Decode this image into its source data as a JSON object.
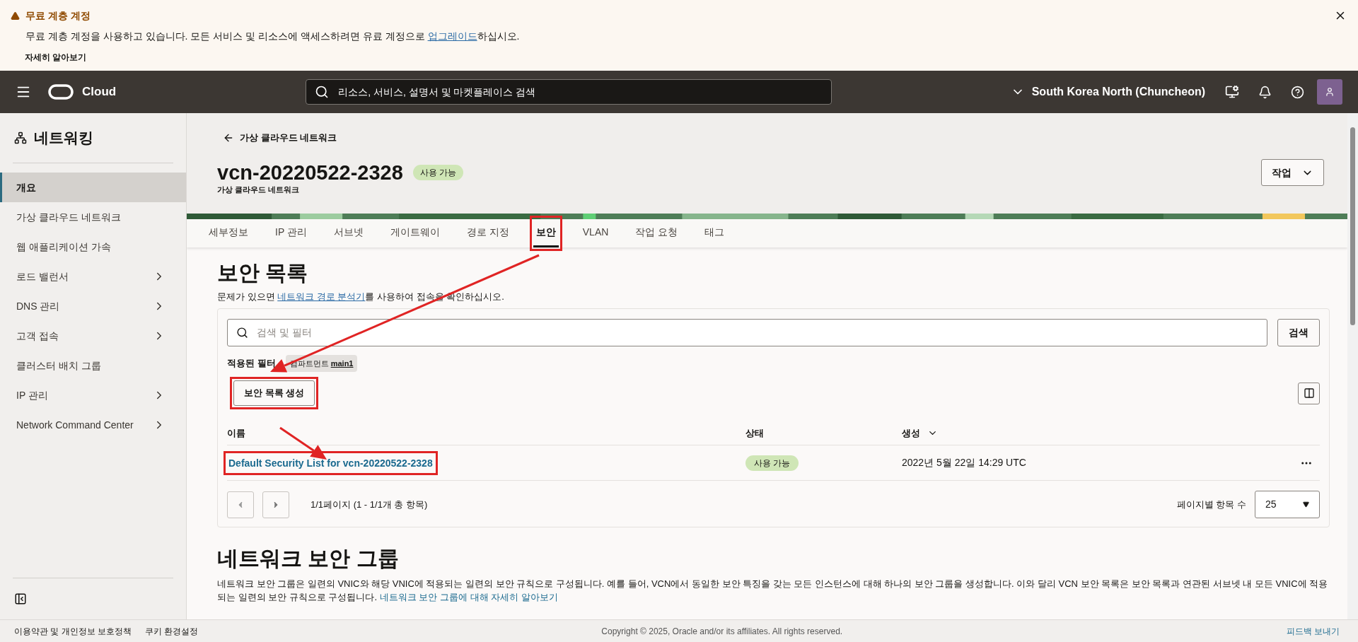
{
  "banner": {
    "title": "무료 계층 계정",
    "message_before": "무료 계층 계정을 사용하고 있습니다. 모든 서비스 및 리소스에 액세스하려면 유료 계정으로 ",
    "message_link": "업그레이드",
    "message_after": "하십시오.",
    "learn_more": "자세히 알아보기"
  },
  "header": {
    "brand": "Cloud",
    "search_placeholder": "리소스, 서비스, 설명서 및 마켓플레이스 검색",
    "region": "South Korea North (Chuncheon)"
  },
  "sidebar": {
    "title": "네트워킹",
    "items": [
      {
        "label": "개요",
        "selected": true,
        "expandable": false
      },
      {
        "label": "가상 클라우드 네트워크",
        "selected": false,
        "expandable": false
      },
      {
        "label": "웹 애플리케이션 가속",
        "selected": false,
        "expandable": false
      },
      {
        "label": "로드 밸런서",
        "selected": false,
        "expandable": true
      },
      {
        "label": "DNS 관리",
        "selected": false,
        "expandable": true
      },
      {
        "label": "고객 접속",
        "selected": false,
        "expandable": true
      },
      {
        "label": "클러스터 배치 그룹",
        "selected": false,
        "expandable": false
      },
      {
        "label": "IP 관리",
        "selected": false,
        "expandable": true
      },
      {
        "label": "Network Command Center",
        "selected": false,
        "expandable": true
      }
    ]
  },
  "page": {
    "back_link": "가상 클라우드 네트워크",
    "title": "vcn-20220522-2328",
    "status": "사용 가능",
    "subtitle": "가상 클라우드 네트워크",
    "actions_button": "작업",
    "tabs": [
      {
        "label": "세부정보",
        "selected": false,
        "highlighted": false
      },
      {
        "label": "IP 관리",
        "selected": false,
        "highlighted": false
      },
      {
        "label": "서브넷",
        "selected": false,
        "highlighted": false
      },
      {
        "label": "게이트웨이",
        "selected": false,
        "highlighted": false
      },
      {
        "label": "경로 지정",
        "selected": false,
        "highlighted": false
      },
      {
        "label": "보안",
        "selected": true,
        "highlighted": true
      },
      {
        "label": "VLAN",
        "selected": false,
        "highlighted": false
      },
      {
        "label": "작업 요청",
        "selected": false,
        "highlighted": false
      },
      {
        "label": "태그",
        "selected": false,
        "highlighted": false
      }
    ]
  },
  "security_lists": {
    "heading": "보안 목록",
    "desc_before": "문제가 있으면 ",
    "desc_link": "네트워크 경로 분석기",
    "desc_after": "를 사용하여 접속을 확인하십시오.",
    "search_placeholder": "검색 및 필터",
    "search_button": "검색",
    "filter_label": "적용된 필터",
    "filter_chip": {
      "name": "컴파트먼트",
      "value": "main1"
    },
    "create_button": {
      "label": "보안 목록 생성",
      "highlighted": true
    },
    "columns": [
      {
        "label": "이름",
        "sortable": false
      },
      {
        "label": "상태",
        "sortable": false
      },
      {
        "label": "생성",
        "sortable": true
      }
    ],
    "rows": [
      {
        "name": "Default Security List for vcn-20220522-2328",
        "status": "사용 가능",
        "created": "2022년 5월 22일 14:29 UTC",
        "highlighted": true
      }
    ],
    "pagination": "1/1페이지 (1 - 1/1개 총 항목)",
    "per_page_label": "페이지별 항목 수",
    "per_page_value": "25"
  },
  "nsg": {
    "heading": "네트워크 보안 그룹",
    "desc": "네트워크 보안 그룹은 일련의 VNIC와 해당 VNIC에 적용되는 일련의 보안 규칙으로 구성됩니다. 예를 들어, VCN에서 동일한 보안 특징을 갖는 모든 인스턴스에 대해 하나의 보안 그룹을 생성합니다. 이와 달리 VCN 보안 목록은 보안 목록과 연관된 서브넷 내 모든 VNIC에 적용되는 일련의 보안 규칙으로 구성됩니다. ",
    "link": "네트워크 보안 그룹에 대해 자세히 알아보기"
  },
  "footer": {
    "terms": "이용약관 및 개인정보 보호정책",
    "cookies": "쿠키 환경설정",
    "copyright": "Copyright © 2025, Oracle and/or its affiliates. All rights reserved.",
    "feedback": "피드백 보내기"
  }
}
